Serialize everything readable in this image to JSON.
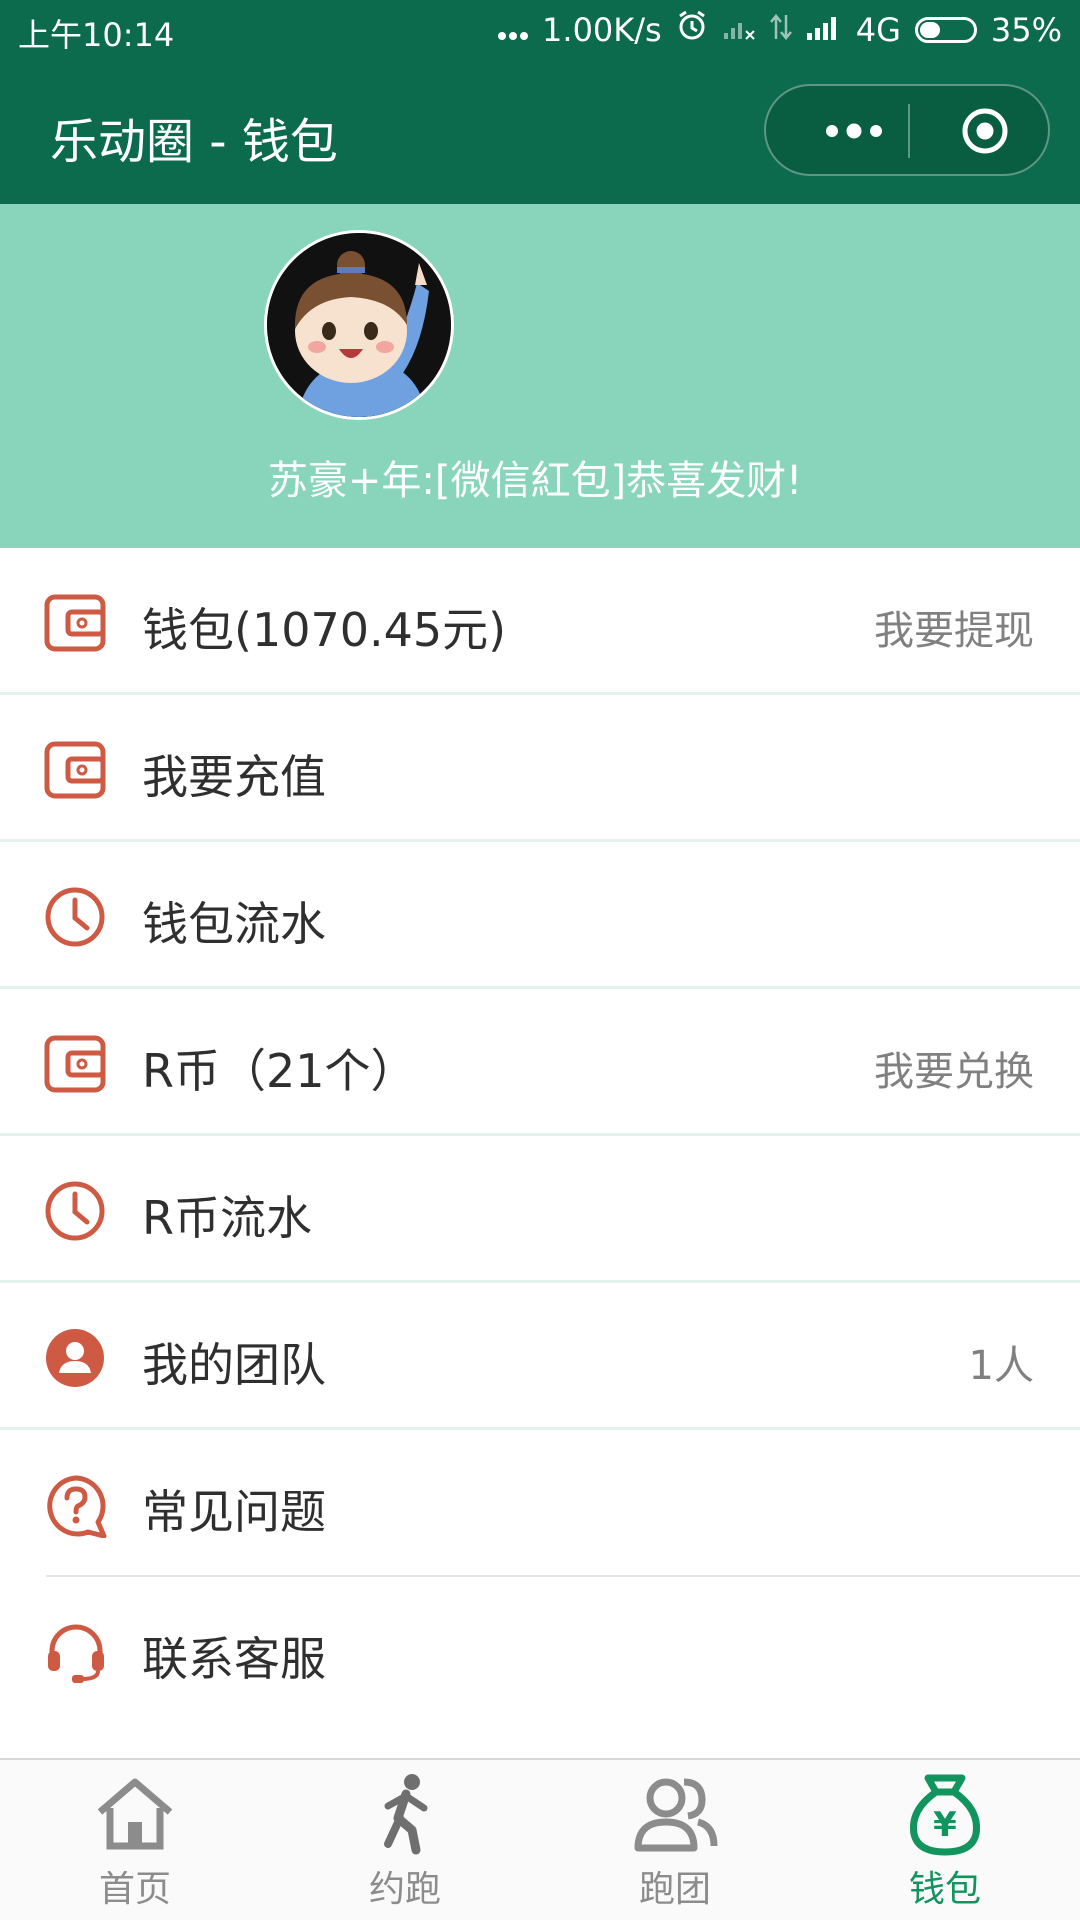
{
  "status_bar": {
    "time": "上午10:14",
    "speed": "1.00K/s",
    "network": "4G",
    "battery": "35%",
    "icons": [
      "dots-icon",
      "alarm-icon",
      "sim-no-signal-icon",
      "data-arrows-icon",
      "signal-icon",
      "battery-icon"
    ]
  },
  "nav": {
    "title": "乐动圈 - 钱包",
    "menu_icon": "more-dots-icon",
    "close_icon": "target-circle-icon"
  },
  "header": {
    "avatar": "avatar",
    "note": "苏豪+年:[微信紅包]恭喜发财!"
  },
  "menu": [
    {
      "label": "钱包(1070.45元)",
      "right": "我要提现",
      "icon": "wallet-icon"
    },
    {
      "label": "我要充值",
      "right": "",
      "icon": "wallet-icon"
    },
    {
      "label": "钱包流水",
      "right": "",
      "icon": "clock-icon"
    },
    {
      "label": "R币（21个）",
      "right": "我要兑换",
      "icon": "wallet-icon"
    },
    {
      "label": "R币流水",
      "right": "",
      "icon": "clock-icon"
    },
    {
      "label": "我的团队",
      "right": "1人",
      "icon": "user-icon"
    },
    {
      "label": "常见问题",
      "right": "",
      "icon": "question-icon"
    },
    {
      "label": "联系客服",
      "right": "",
      "icon": "headset-icon"
    }
  ],
  "tabs": [
    {
      "label": "首页",
      "icon": "home-icon",
      "active": false
    },
    {
      "label": "约跑",
      "icon": "runner-icon",
      "active": false
    },
    {
      "label": "跑团",
      "icon": "group-icon",
      "active": false
    },
    {
      "label": "钱包",
      "icon": "money-bag-icon",
      "active": true
    }
  ],
  "colors": {
    "nav_bg": "#0b6b4c",
    "header_bg": "#88d5bb",
    "icon_accent": "#cf5a43",
    "tab_active": "#12945f",
    "tab_inactive": "#8c8c8c"
  }
}
